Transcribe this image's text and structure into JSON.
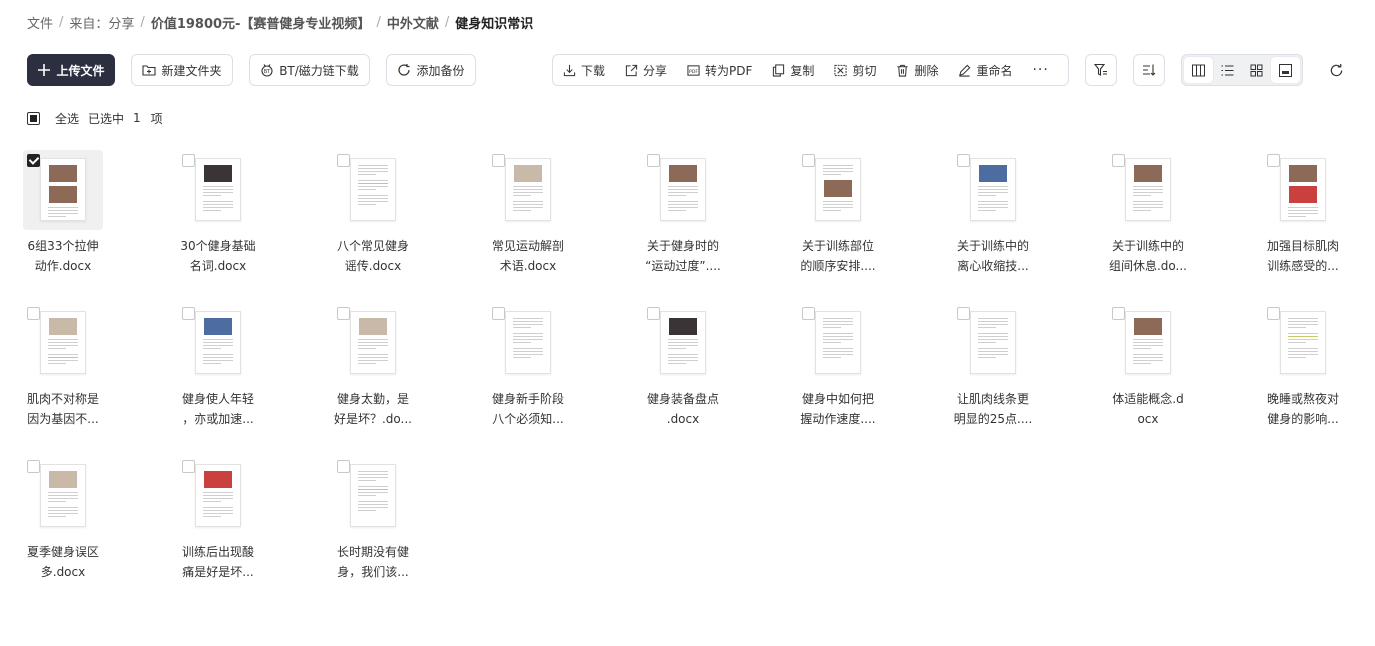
{
  "breadcrumb": [
    "文件",
    "来自：分享",
    "价值19800元-【赛普健身专业视频】",
    "中外文献",
    "健身知识常识"
  ],
  "toolbar": {
    "upload": "上传文件",
    "new_folder": "新建文件夹",
    "bt": "BT/磁力链下载",
    "backup": "添加备份",
    "actions": {
      "download": "下载",
      "share": "分享",
      "to_pdf": "转为PDF",
      "copy": "复制",
      "cut": "剪切",
      "delete": "删除",
      "rename": "重命名",
      "more": "···"
    }
  },
  "selection": {
    "select_all": "全选",
    "selected_prefix": "已选中",
    "count": "1",
    "unit": "项"
  },
  "files": [
    {
      "line1": "6组33个拉伸",
      "line2": "动作.docx"
    },
    {
      "line1": "30个健身基础",
      "line2": "名词.docx"
    },
    {
      "line1": "八个常见健身",
      "line2": "谣传.docx"
    },
    {
      "line1": "常见运动解剖",
      "line2": "术语.docx"
    },
    {
      "line1": "关于健身时的",
      "line2": "“运动过度”...."
    },
    {
      "line1": "关于训练部位",
      "line2": "的顺序安排...."
    },
    {
      "line1": "关于训练中的",
      "line2": "离心收缩技..."
    },
    {
      "line1": "关于训练中的",
      "line2": "组间休息.do..."
    },
    {
      "line1": "加强目标肌肉",
      "line2": "训练感受的..."
    },
    {
      "line1": "肌肉不对称是",
      "line2": "因为基因不..."
    },
    {
      "line1": "健身使人年轻",
      "line2": "，亦或加速..."
    },
    {
      "line1": "健身太勤，是",
      "line2": "好是坏？.do..."
    },
    {
      "line1": "健身新手阶段",
      "line2": "八个必须知..."
    },
    {
      "line1": "健身装备盘点",
      "line2": ".docx"
    },
    {
      "line1": "健身中如何把",
      "line2": "握动作速度...."
    },
    {
      "line1": "让肌肉线条更",
      "line2": "明显的25点...."
    },
    {
      "line1": "体适能概念.d",
      "line2": "ocx"
    },
    {
      "line1": "晚睡或熬夜对",
      "line2": "健身的影响..."
    },
    {
      "line1": "夏季健身误区",
      "line2": "多.docx"
    },
    {
      "line1": "训练后出现酸",
      "line2": "痛是好是坏..."
    },
    {
      "line1": "长时期没有健",
      "line2": "身，我们该..."
    }
  ],
  "colors": {
    "primary": "#2b2f3f",
    "border": "#dcdfe6",
    "selected_bg": "#f0f0f1"
  }
}
